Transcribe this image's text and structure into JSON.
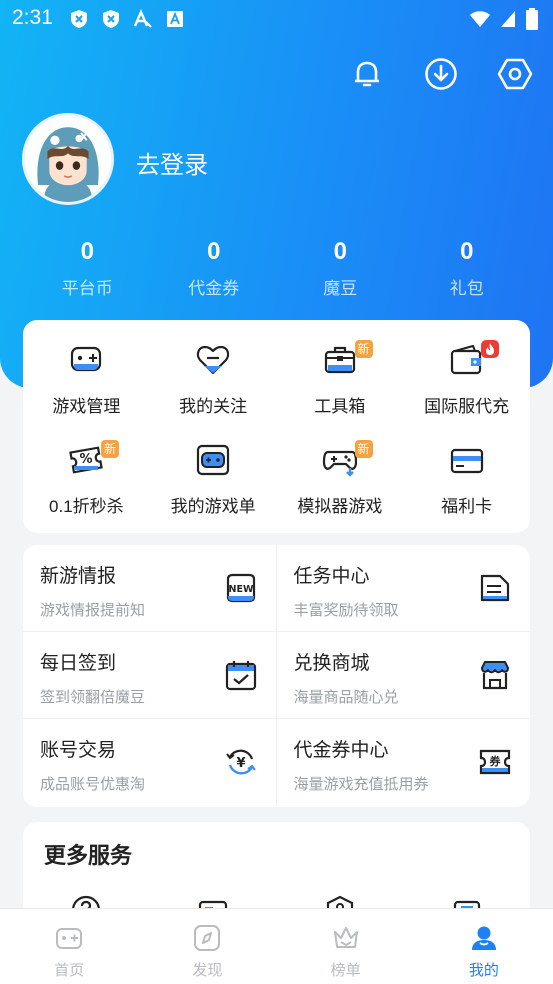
{
  "status": {
    "time": "2:31"
  },
  "colors": {
    "accent": "#1f80f3",
    "header_start": "#12b4f5",
    "header_end": "#1f74f3",
    "badge_new": "#f5a340",
    "badge_hot": "#ef3b33"
  },
  "header": {
    "icons": [
      "bell-icon",
      "download-icon",
      "settings-icon"
    ],
    "login_label": "去登录"
  },
  "stats": [
    {
      "value": "0",
      "label": "平台币"
    },
    {
      "value": "0",
      "label": "代金券"
    },
    {
      "value": "0",
      "label": "魔豆"
    },
    {
      "value": "0",
      "label": "礼包"
    }
  ],
  "grid": [
    {
      "label": "游戏管理",
      "icon": "gamepad-icon"
    },
    {
      "label": "我的关注",
      "icon": "heart-icon"
    },
    {
      "label": "工具箱",
      "icon": "toolbox-icon",
      "badge": "新"
    },
    {
      "label": "国际服代充",
      "icon": "wallet-icon",
      "badge": "hot"
    },
    {
      "label": "0.1折秒杀",
      "icon": "discount-icon",
      "badge": "新"
    },
    {
      "label": "我的游戏单",
      "icon": "game-list-icon"
    },
    {
      "label": "模拟器游戏",
      "icon": "emulator-icon",
      "badge": "新"
    },
    {
      "label": "福利卡",
      "icon": "card-icon"
    }
  ],
  "features": [
    {
      "title": "新游情报",
      "subtitle": "游戏情报提前知",
      "icon": "new-icon",
      "icon_text": "NEW"
    },
    {
      "title": "任务中心",
      "subtitle": "丰富奖励待领取",
      "icon": "task-icon"
    },
    {
      "title": "每日签到",
      "subtitle": "签到领翻倍魔豆",
      "icon": "calendar-check-icon"
    },
    {
      "title": "兑换商城",
      "subtitle": "海量商品随心兑",
      "icon": "shop-icon"
    },
    {
      "title": "账号交易",
      "subtitle": "成品账号优惠淘",
      "icon": "yen-exchange-icon",
      "icon_text": "¥"
    },
    {
      "title": "代金券中心",
      "subtitle": "海量游戏充值抵用券",
      "icon": "coupon-icon",
      "icon_text": "券"
    }
  ],
  "more": {
    "title": "更多服务"
  },
  "nav": [
    {
      "label": "首页",
      "icon": "home-gamepad-icon",
      "active": false
    },
    {
      "label": "发现",
      "icon": "compass-icon",
      "active": false
    },
    {
      "label": "榜单",
      "icon": "crown-icon",
      "active": false
    },
    {
      "label": "我的",
      "icon": "user-icon",
      "active": true
    }
  ]
}
